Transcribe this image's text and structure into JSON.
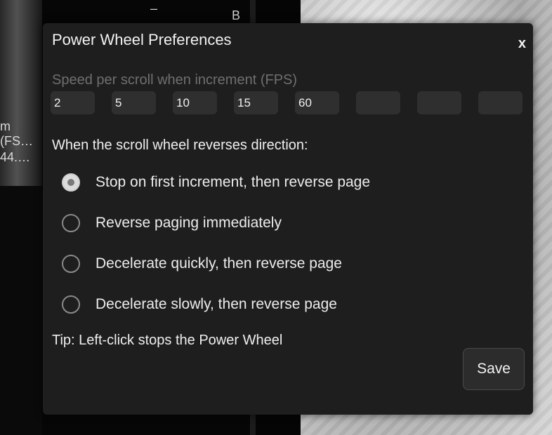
{
  "background": {
    "partial_label_top": "B",
    "partial_label_dash": "–",
    "left_texts": [
      "m",
      "(FS…",
      "44.…"
    ]
  },
  "dialog": {
    "title": "Power Wheel Preferences",
    "close_label": "x",
    "fps_label": "Speed per scroll when increment (FPS)",
    "fps_values": [
      "2",
      "5",
      "10",
      "15",
      "60",
      "",
      "",
      ""
    ],
    "reverse_label": "When the scroll wheel reverses direction:",
    "options": [
      {
        "label": "Stop on first increment, then reverse page",
        "checked": true
      },
      {
        "label": "Reverse paging immediately",
        "checked": false
      },
      {
        "label": "Decelerate quickly, then reverse page",
        "checked": false
      },
      {
        "label": "Decelerate slowly, then reverse page",
        "checked": false
      }
    ],
    "tip": "Tip: Left-click stops the Power Wheel",
    "save_label": "Save"
  }
}
